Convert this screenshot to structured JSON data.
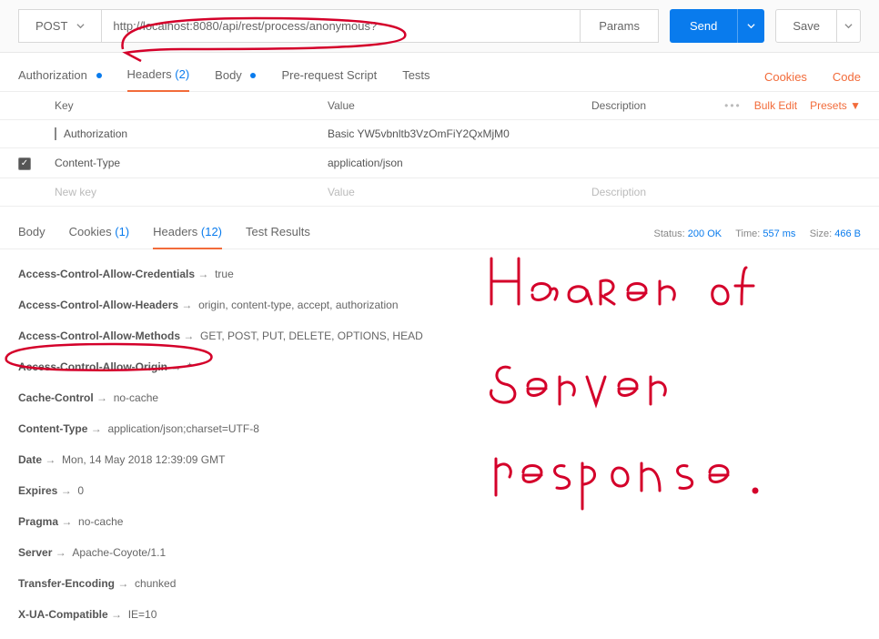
{
  "request": {
    "method": "POST",
    "url": "http://localhost:8080/api/rest/process/anonymous?",
    "params_label": "Params",
    "send_label": "Send",
    "save_label": "Save"
  },
  "request_tabs": {
    "authorization": "Authorization",
    "headers": "Headers",
    "headers_count": "(2)",
    "body": "Body",
    "prerequest": "Pre-request Script",
    "tests": "Tests",
    "cookies_link": "Cookies",
    "code_link": "Code"
  },
  "headers_table": {
    "key_header": "Key",
    "value_header": "Value",
    "desc_header": "Description",
    "bulk_edit": "Bulk Edit",
    "presets": "Presets ▼",
    "rows": [
      {
        "key": "Authorization",
        "value": "Basic YW5vbnltb3VzOmFiY2QxMjM0",
        "checked": false,
        "bar": true
      },
      {
        "key": "Content-Type",
        "value": "application/json",
        "checked": true,
        "bar": false
      }
    ],
    "placeholder": {
      "key": "New key",
      "value": "Value",
      "desc": "Description"
    }
  },
  "response_tabs": {
    "body": "Body",
    "cookies": "Cookies",
    "cookies_count": "(1)",
    "headers": "Headers",
    "headers_count": "(12)",
    "test_results": "Test Results"
  },
  "response_meta": {
    "status_label": "Status:",
    "status_value": "200 OK",
    "time_label": "Time:",
    "time_value": "557 ms",
    "size_label": "Size:",
    "size_value": "466 B"
  },
  "response_headers": [
    {
      "key": "Access-Control-Allow-Credentials",
      "value": "true"
    },
    {
      "key": "Access-Control-Allow-Headers",
      "value": "origin, content-type, accept, authorization"
    },
    {
      "key": "Access-Control-Allow-Methods",
      "value": "GET, POST, PUT, DELETE, OPTIONS, HEAD"
    },
    {
      "key": "Access-Control-Allow-Origin",
      "value": "*"
    },
    {
      "key": "Cache-Control",
      "value": "no-cache"
    },
    {
      "key": "Content-Type",
      "value": "application/json;charset=UTF-8"
    },
    {
      "key": "Date",
      "value": "Mon, 14 May 2018 12:39:09 GMT"
    },
    {
      "key": "Expires",
      "value": "0"
    },
    {
      "key": "Pragma",
      "value": "no-cache"
    },
    {
      "key": "Server",
      "value": "Apache-Coyote/1.1"
    },
    {
      "key": "Transfer-Encoding",
      "value": "chunked"
    },
    {
      "key": "X-UA-Compatible",
      "value": "IE=10"
    }
  ],
  "annotations": {
    "handwritten": "Header of server response."
  }
}
